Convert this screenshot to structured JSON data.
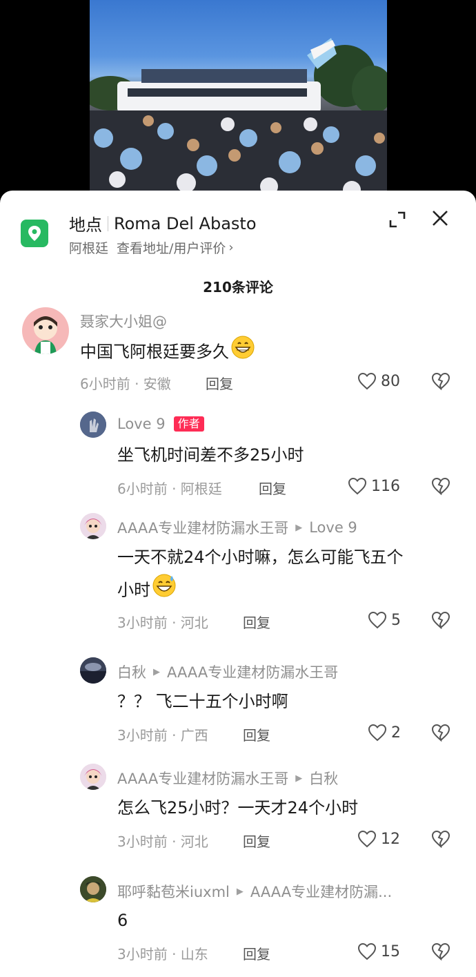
{
  "location": {
    "label": "地点",
    "name": "Roma Del Abasto",
    "region": "阿根廷",
    "link_text": "查看地址/用户评价"
  },
  "comments_header": "210条评论",
  "colors": {
    "location_icon": "#27b961",
    "author_tag": "#fe2c55",
    "name_gray": "#8f8f8f"
  },
  "comments": [
    {
      "username": "聂家大小姐@",
      "text": "中国飞阿根廷要多久",
      "time_place": "6小时前 · 安徽",
      "reply": "回复",
      "likes": "80",
      "emoji": "grinning-emoji"
    },
    {
      "username": "Love 9",
      "author_tag": "作者",
      "text": "坐飞机时间差不多25小时",
      "time_place": "6小时前 · 阿根廷",
      "reply": "回复",
      "likes": "116"
    },
    {
      "username": "AAAA专业建材防漏水王哥",
      "reply_to": "Love 9",
      "text_line1": "一天不就24个小时嘛，怎么可能飞五个",
      "text_line2": "小时",
      "time_place": "3小时前 · 河北",
      "reply": "回复",
      "likes": "5",
      "emoji": "sweat-smile-emoji"
    },
    {
      "username": "白秋",
      "reply_to": "AAAA专业建材防漏水王哥",
      "text": "？？ 飞二十五个小时啊",
      "time_place": "3小时前 · 广西",
      "reply": "回复",
      "likes": "2"
    },
    {
      "username": "AAAA专业建材防漏水王哥",
      "reply_to": "白秋",
      "text": "怎么飞25小时？一天才24个小时",
      "time_place": "3小时前 · 河北",
      "reply": "回复",
      "likes": "12"
    },
    {
      "username": "耶呼黏苞米iuxml",
      "reply_to": "AAAA专业建材防漏...",
      "text": "6",
      "time_place": "3小时前 · 山东",
      "reply": "回复",
      "likes": "15"
    }
  ]
}
